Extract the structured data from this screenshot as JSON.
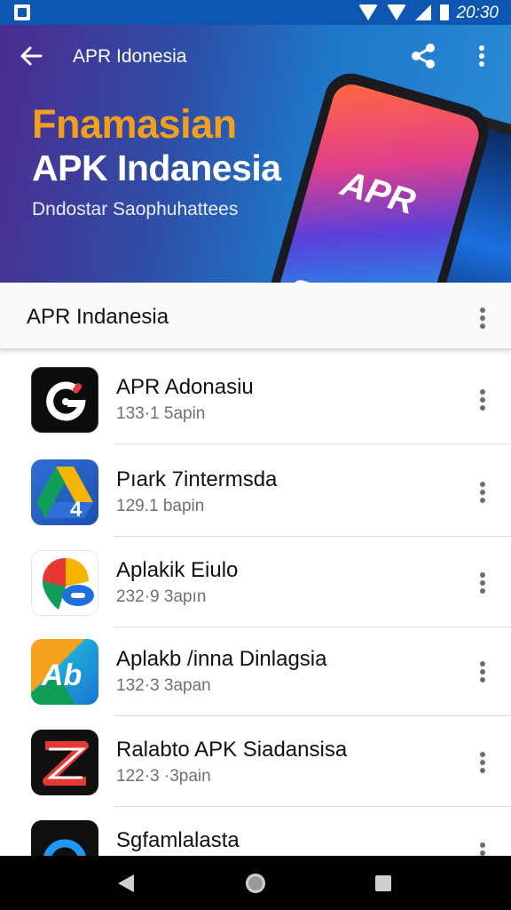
{
  "status_bar": {
    "time": "20:30"
  },
  "app_bar": {
    "title": "APR Idonesia"
  },
  "hero": {
    "headline_1": "Fnamasian",
    "headline_2": "APK Indanesia",
    "subtitle": "Dndostar Saophuhattees",
    "phone_brand": "APR"
  },
  "section": {
    "title": "APR Indanesia"
  },
  "apps": [
    {
      "name": "APR Adonasiu",
      "meta": "133·1 5apin",
      "icon": "app-icon-g-logo"
    },
    {
      "name": "Pıark 7intermsda",
      "meta": "129.1 bapin",
      "icon": "app-icon-drive-logo"
    },
    {
      "name": "Aplakik Eiulo",
      "meta": "232·9 3apın",
      "icon": "app-icon-maps-logo"
    },
    {
      "name": "Aplakb /inna Dinlagsia",
      "meta": "132·3 3apan",
      "icon": "app-icon-ab-logo"
    },
    {
      "name": "Ralabto APK Siadansisa",
      "meta": "122·3 ·3pain",
      "icon": "app-icon-z-logo"
    },
    {
      "name": "Sgfamlalasta",
      "meta": "",
      "icon": "app-icon-ring-logo"
    }
  ]
}
